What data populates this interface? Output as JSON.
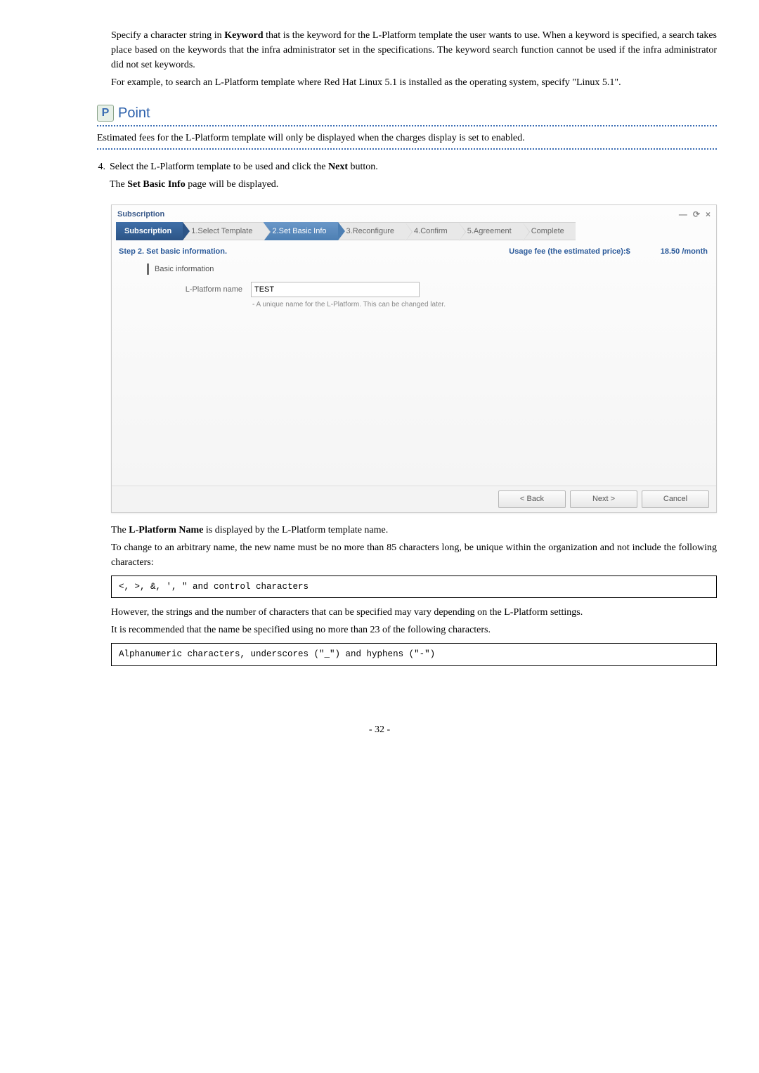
{
  "top_paras": {
    "p1a": "Specify a character string in ",
    "p1b": "Keyword",
    "p1c": " that is the keyword for the L-Platform template the user wants to use. When a keyword is specified, a search takes place based on the keywords that the infra administrator set in the specifications. The keyword search function cannot be used if the infra administrator did not set keywords.",
    "p2": "For example, to search an L-Platform template where Red Hat Linux 5.1 is installed as the operating system, specify \"Linux 5.1\"."
  },
  "point": {
    "icon_letter": "P",
    "label": "Point",
    "text": "Estimated fees for the L-Platform template will only be displayed when the charges display is set to enabled."
  },
  "step4": {
    "number": "4.",
    "line1a": "Select the L-Platform template to be used and click the ",
    "line1b": "Next",
    "line1c": " button.",
    "line2a": "The ",
    "line2b": "Set Basic Info",
    "line2c": " page will be displayed."
  },
  "screenshot": {
    "window_title": "Subscription",
    "win_minimize": "—",
    "win_maximize": "⟳",
    "win_close": "×",
    "tabs": {
      "head": "Subscription",
      "t1": "1.Select Template",
      "t2": "2.Set Basic Info",
      "t3": "3.Reconfigure",
      "t4": "4.Confirm",
      "t5": "5.Agreement",
      "t6": "Complete"
    },
    "step_label": "Step 2. Set basic information.",
    "usage_label": "Usage fee (the estimated price):$",
    "usage_price": "18.50 /month",
    "section_title": "Basic information",
    "form_label": "L-Platform name",
    "input_value": "TEST",
    "hint": "- A unique name for the L-Platform. This can be changed later.",
    "btn_back": "< Back",
    "btn_next": "Next >",
    "btn_cancel": "Cancel"
  },
  "below": {
    "p1a": "The ",
    "p1b": "L-Platform Name",
    "p1c": " is displayed by the L-Platform template name.",
    "p2": "To change to an arbitrary name, the new name must be no more than 85 characters long, be unique within the organization and not include the following characters:"
  },
  "code1": "<, >, &, ', \" and control characters",
  "below2": {
    "p1": "However, the strings and the number of characters that can be specified may vary depending on the L-Platform settings.",
    "p2": "It is recommended that the name be specified using no more than 23 of the following characters."
  },
  "code2": "Alphanumeric characters, underscores (\"_\") and hyphens (\"-\")",
  "page_number": "- 32 -"
}
